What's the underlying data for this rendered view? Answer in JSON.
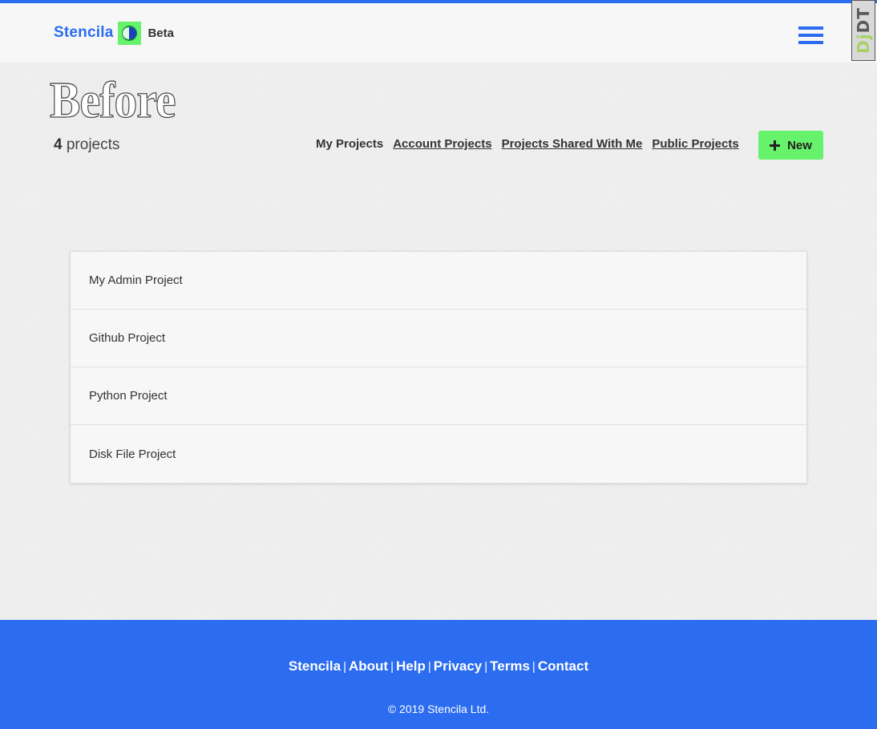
{
  "header": {
    "brand_name": "Stencila",
    "brand_badge": "Beta",
    "logo_icon": "stencila-logo-icon",
    "menu_icon": "hamburger-menu-icon"
  },
  "debug_toolbar": {
    "label_prefix": "Dj",
    "label_suffix": "DT"
  },
  "page": {
    "title": "Before",
    "count": "4",
    "count_label": "projects"
  },
  "filters": [
    {
      "label": "My Projects",
      "active": true
    },
    {
      "label": "Account Projects",
      "active": false
    },
    {
      "label": "Projects Shared With Me",
      "active": false
    },
    {
      "label": "Public Projects",
      "active": false
    }
  ],
  "new_button": {
    "label": "New",
    "icon": "plus-icon"
  },
  "projects": [
    {
      "name": "My Admin Project"
    },
    {
      "name": "Github Project"
    },
    {
      "name": "Python Project"
    },
    {
      "name": "Disk File Project"
    }
  ],
  "footer": {
    "links": [
      "Stencila",
      "About",
      "Help",
      "Privacy",
      "Terms",
      "Contact"
    ],
    "separator": "|",
    "copyright": "© 2019 Stencila Ltd."
  },
  "colors": {
    "brand_blue": "#2b6cf0",
    "accent_green": "#66f36b",
    "background": "#f1f1f1"
  }
}
